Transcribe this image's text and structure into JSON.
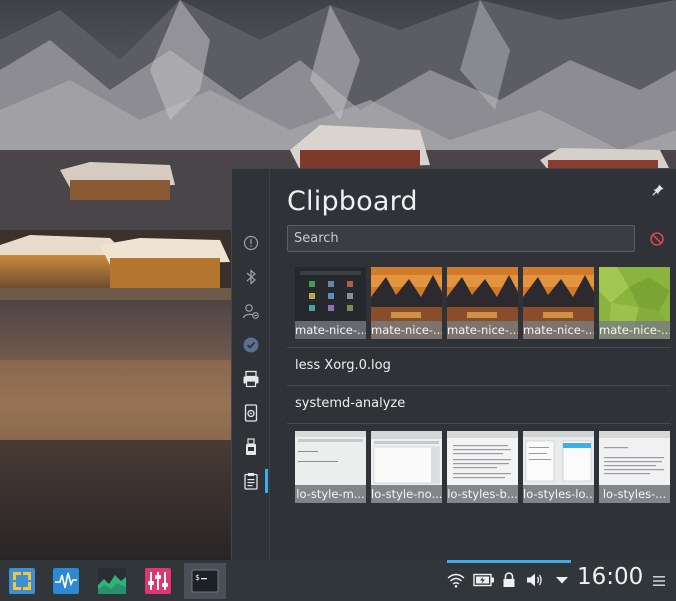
{
  "clipboard": {
    "title": "Clipboard",
    "search_placeholder": "Search",
    "image_row": [
      {
        "caption": "mate-nice-...",
        "kind": "menu"
      },
      {
        "caption": "mate-nice-...",
        "kind": "sunset"
      },
      {
        "caption": "mate-nice-...",
        "kind": "sunset"
      },
      {
        "caption": "mate-nice-...",
        "kind": "sunset"
      },
      {
        "caption": "mate-nice-...",
        "kind": "green"
      }
    ],
    "text_items": [
      {
        "label": "less Xorg.0.log"
      },
      {
        "label": "systemd-analyze"
      }
    ],
    "doc_row": [
      {
        "caption": "lo-style-m..."
      },
      {
        "caption": "lo-style-no..."
      },
      {
        "caption": "lo-styles-b..."
      },
      {
        "caption": "lo-styles-lo..."
      },
      {
        "caption": "lo-styles-..."
      }
    ]
  },
  "sidebar_icons": [
    "notifications-icon",
    "bluetooth-icon",
    "user-switch-icon",
    "updates-check-icon",
    "printer-icon",
    "device-notifier-icon",
    "usb-drive-icon",
    "clipboard-icon"
  ],
  "taskbar": {
    "clock": "16:00",
    "launchers": [
      "application-launcher-icon",
      "system-monitor-icon",
      "ksysguard-icon",
      "mixer-icon",
      "terminal-icon"
    ],
    "tray": [
      "wifi-icon",
      "battery-icon",
      "lock-icon",
      "volume-icon",
      "expand-tray-icon"
    ]
  },
  "colors": {
    "accent": "#3daee9",
    "popup_bg": "#2f3237",
    "taskbar_bg": "#31363b",
    "stop_red": "#da4453"
  }
}
